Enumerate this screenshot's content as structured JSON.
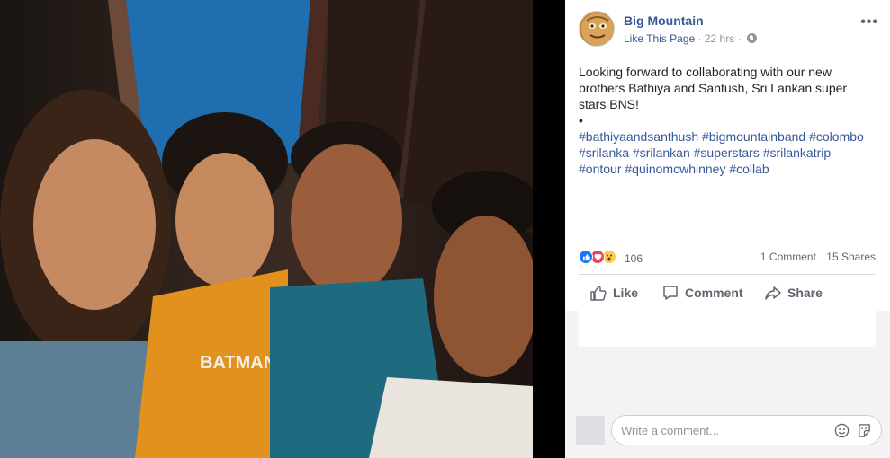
{
  "post": {
    "page_name": "Big Mountain",
    "like_page_label": "Like This Page",
    "separator": "·",
    "time": "22 hrs",
    "text_line": "Looking forward to collaborating with our new brothers Bathiya and Santush, Sri Lankan super stars BNS!",
    "bullet": "•",
    "hashtags": [
      "#bathiyaandsanthush",
      "#bigmountainband",
      "#colombo",
      "#srilanka",
      "#srilankan",
      "#superstars",
      "#srilankatrip",
      "#ontour",
      "#quinomcwhinney",
      "#collab"
    ]
  },
  "stats": {
    "reaction_count": "106",
    "comments": "1 Comment",
    "shares": "15 Shares"
  },
  "actions": {
    "like": "Like",
    "comment": "Comment",
    "share": "Share"
  },
  "composer": {
    "placeholder": "Write a comment..."
  },
  "icons": {
    "like": "thumbs-up-icon",
    "comment": "speech-bubble-icon",
    "share": "share-arrow-icon",
    "emoji": "emoji-icon",
    "sticker": "sticker-icon",
    "privacy": "globe-icon",
    "more": "more-options-icon"
  },
  "colors": {
    "link": "#365899",
    "meta": "#90949c",
    "like_reaction": "#1877f2",
    "love_reaction": "#f33e58",
    "wow_reaction": "#fbcd47"
  }
}
